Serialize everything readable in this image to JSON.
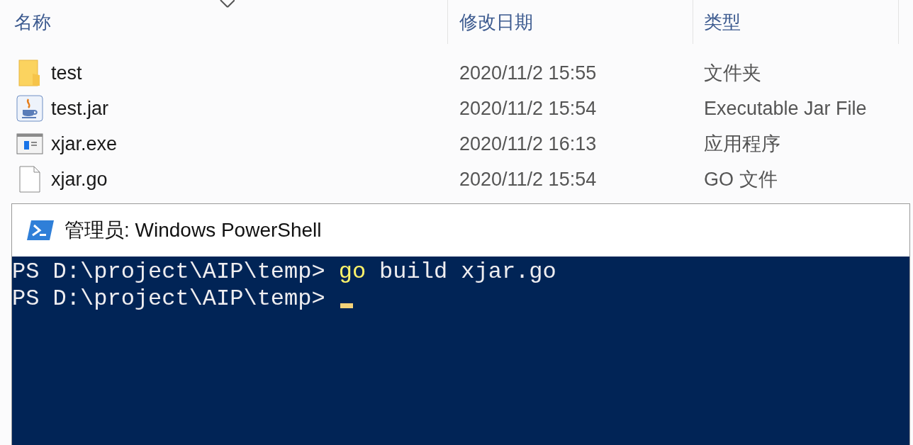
{
  "explorer": {
    "columns": [
      "名称",
      "修改日期",
      "类型"
    ],
    "files": [
      {
        "name": "test",
        "date": "2020/11/2 15:55",
        "type": "文件夹",
        "kind": "folder"
      },
      {
        "name": "test.jar",
        "date": "2020/11/2 15:54",
        "type": "Executable Jar File",
        "kind": "jar"
      },
      {
        "name": "xjar.exe",
        "date": "2020/11/2 16:13",
        "type": "应用程序",
        "kind": "exe"
      },
      {
        "name": "xjar.go",
        "date": "2020/11/2 15:54",
        "type": "GO 文件",
        "kind": "file"
      }
    ]
  },
  "powershell": {
    "title": "管理员: Windows PowerShell",
    "lines": [
      {
        "prompt": "PS D:\\project\\AIP\\temp>",
        "command": "go",
        "args": "build xjar.go"
      },
      {
        "prompt": "PS D:\\project\\AIP\\temp>"
      }
    ],
    "cursor": true
  }
}
